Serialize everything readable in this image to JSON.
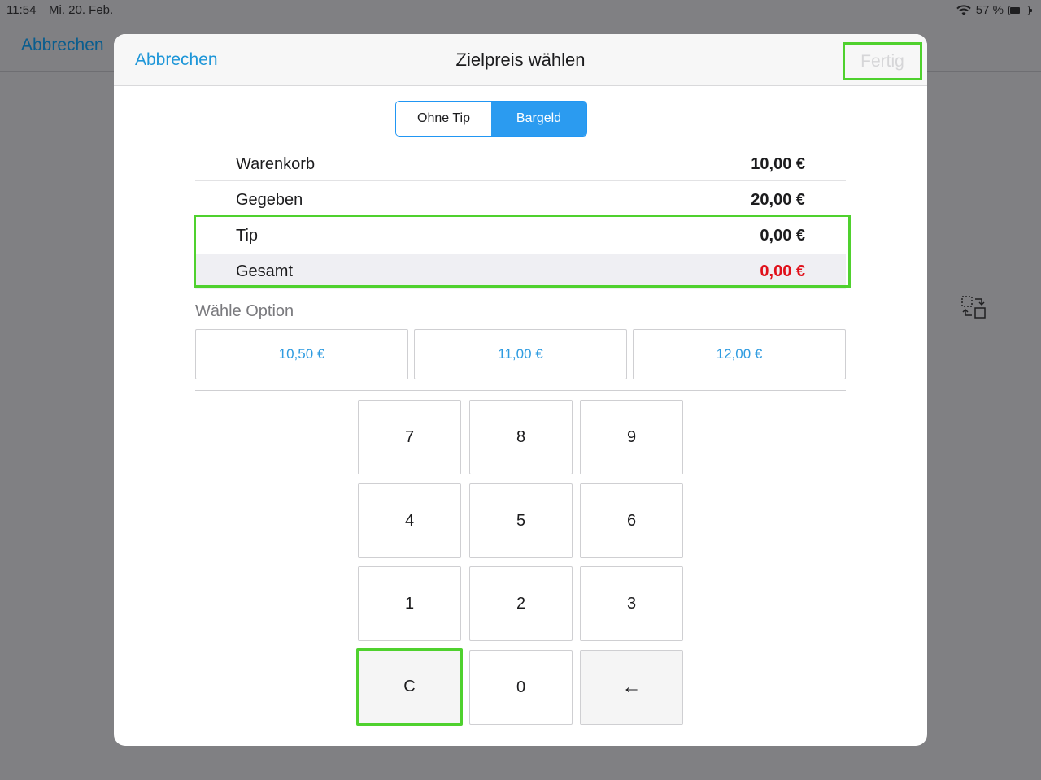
{
  "status_bar": {
    "time": "11:54",
    "date": "Mi. 20. Feb.",
    "battery": "57 %",
    "battery_level": 0.57
  },
  "background": {
    "cancel_label": "Abbrechen",
    "swap_icon": "swap-screens-icon"
  },
  "modal": {
    "title": "Zielpreis wählen",
    "cancel_label": "Abbrechen",
    "done_label": "Fertig",
    "segments": [
      {
        "label": "Ohne Tip",
        "selected": false
      },
      {
        "label": "Bargeld",
        "selected": true
      }
    ],
    "rows": [
      {
        "label": "Warenkorb",
        "value": "10,00 €"
      },
      {
        "label": "Gegeben",
        "value": "20,00 €"
      },
      {
        "label": "Tip",
        "value": "0,00 €"
      },
      {
        "label": "Gesamt",
        "value": "0,00 €"
      }
    ],
    "options_label": "Wähle Option",
    "options": [
      "10,50 €",
      "11,00 €",
      "12,00 €"
    ],
    "keypad": [
      "7",
      "8",
      "9",
      "4",
      "5",
      "6",
      "1",
      "2",
      "3",
      "C",
      "0",
      "←"
    ]
  },
  "colors": {
    "accent": "#2b9bf0",
    "highlight": "#4fd12e",
    "negative": "#e0101a",
    "overlay": "#808083"
  }
}
